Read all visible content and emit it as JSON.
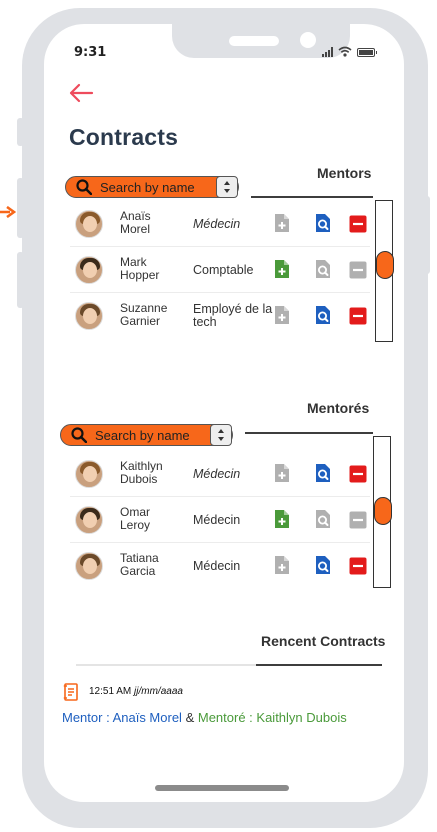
{
  "status_bar": {
    "time": "9:31"
  },
  "page": {
    "title": "Contracts"
  },
  "colors": {
    "accent": "#f7671a",
    "doc_active": "#4a9a3a",
    "doc_inactive": "#b0b0b0",
    "view_active": "#1e5fbf",
    "remove_active": "#e31b1b",
    "disabled": "#b0b0b0"
  },
  "mentors": {
    "label": "Mentors",
    "search_placeholder": "Search by name",
    "rows": [
      {
        "name": "Anaïs Morel",
        "role": "Médecin",
        "role_italic": true,
        "doc": "inactive",
        "view": "active",
        "remove": "active",
        "avatar_hair": "#8a5a2b"
      },
      {
        "name": "Mark Hopper",
        "role": "Comptable",
        "role_italic": false,
        "doc": "active",
        "view": "disabled",
        "remove": "disabled",
        "avatar_hair": "#3a2a1a"
      },
      {
        "name": "Suzanne Garnier",
        "role": "Employé de la tech",
        "role_italic": false,
        "doc": "inactive",
        "view": "active",
        "remove": "active",
        "avatar_hair": "#6b4a2a"
      }
    ]
  },
  "mentores": {
    "label": "Mentorés",
    "search_placeholder": "Search by name",
    "rows": [
      {
        "name": "Kaithlyn Dubois",
        "role": "Médecin",
        "role_italic": true,
        "doc": "inactive",
        "view": "active",
        "remove": "active",
        "avatar_hair": "#8a5a2b"
      },
      {
        "name": "Omar Leroy",
        "role": "Médecin",
        "role_italic": false,
        "doc": "active",
        "view": "disabled",
        "remove": "disabled",
        "avatar_hair": "#3a2a1a"
      },
      {
        "name": "Tatiana Garcia",
        "role": "Médecin",
        "role_italic": false,
        "doc": "inactive",
        "view": "active",
        "remove": "active",
        "avatar_hair": "#6b4a2a"
      }
    ]
  },
  "recent": {
    "label": "Rencent Contracts",
    "time": "12:51 AM",
    "date": "jj/mm/aaaa",
    "mentor_text": "Mentor : Anaïs Morel",
    "amp": "&",
    "mentore_text": "Mentoré : Kaithlyn Dubois"
  }
}
